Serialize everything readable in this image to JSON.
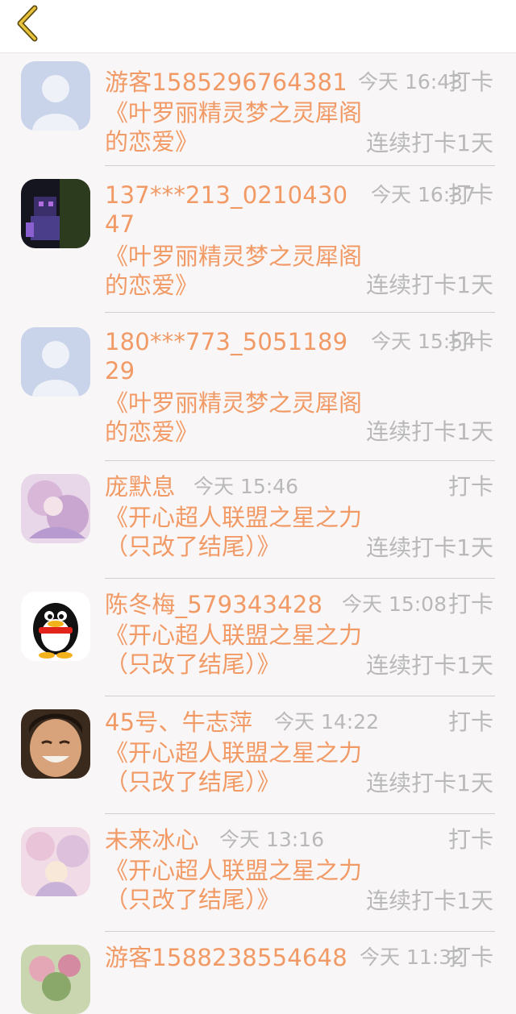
{
  "header": {
    "back_icon": "chevron-left-icon",
    "accent": "#e8c23a"
  },
  "checkins": [
    {
      "name": "游客1585296764381",
      "time": "今天 16:43",
      "action": "打卡",
      "book": "《叶罗丽精灵梦之灵犀阁的恋爱》",
      "streak": "连续打卡1天",
      "avatar": "default-avatar"
    },
    {
      "name": "137***213_021043047",
      "time": "今天 16:37",
      "action": "打卡",
      "book": "《叶罗丽精灵梦之灵犀阁的恋爱》",
      "streak": "连续打卡1天",
      "avatar": "game-character-avatar"
    },
    {
      "name": "180***773_505118929",
      "time": "今天 15:54",
      "action": "打卡",
      "book": "《叶罗丽精灵梦之灵犀阁的恋爱》",
      "streak": "连续打卡1天",
      "avatar": "default-avatar"
    },
    {
      "name": "庞默息",
      "time": "今天 15:46",
      "action": "打卡",
      "book": "《开心超人联盟之星之力（只改了结尾）》",
      "streak": "连续打卡1天",
      "avatar": "anime-girl-avatar"
    },
    {
      "name": "陈冬梅_579343428",
      "time": "今天 15:08",
      "action": "打卡",
      "book": "《开心超人联盟之星之力（只改了结尾）》",
      "streak": "连续打卡1天",
      "avatar": "penguin-avatar"
    },
    {
      "name": "45号、牛志萍",
      "time": "今天 14:22",
      "action": "打卡",
      "book": "《开心超人联盟之星之力（只改了结尾）》",
      "streak": "连续打卡1天",
      "avatar": "smiling-face-avatar"
    },
    {
      "name": "未来冰心",
      "time": "今天 13:16",
      "action": "打卡",
      "book": "《开心超人联盟之星之力（只改了结尾）》",
      "streak": "连续打卡1天",
      "avatar": "pink-anime-avatar"
    },
    {
      "name": "游客1588238554648",
      "time": "今天 11:32",
      "action": "打卡",
      "book": "",
      "streak": "",
      "avatar": "flower-avatar"
    }
  ]
}
